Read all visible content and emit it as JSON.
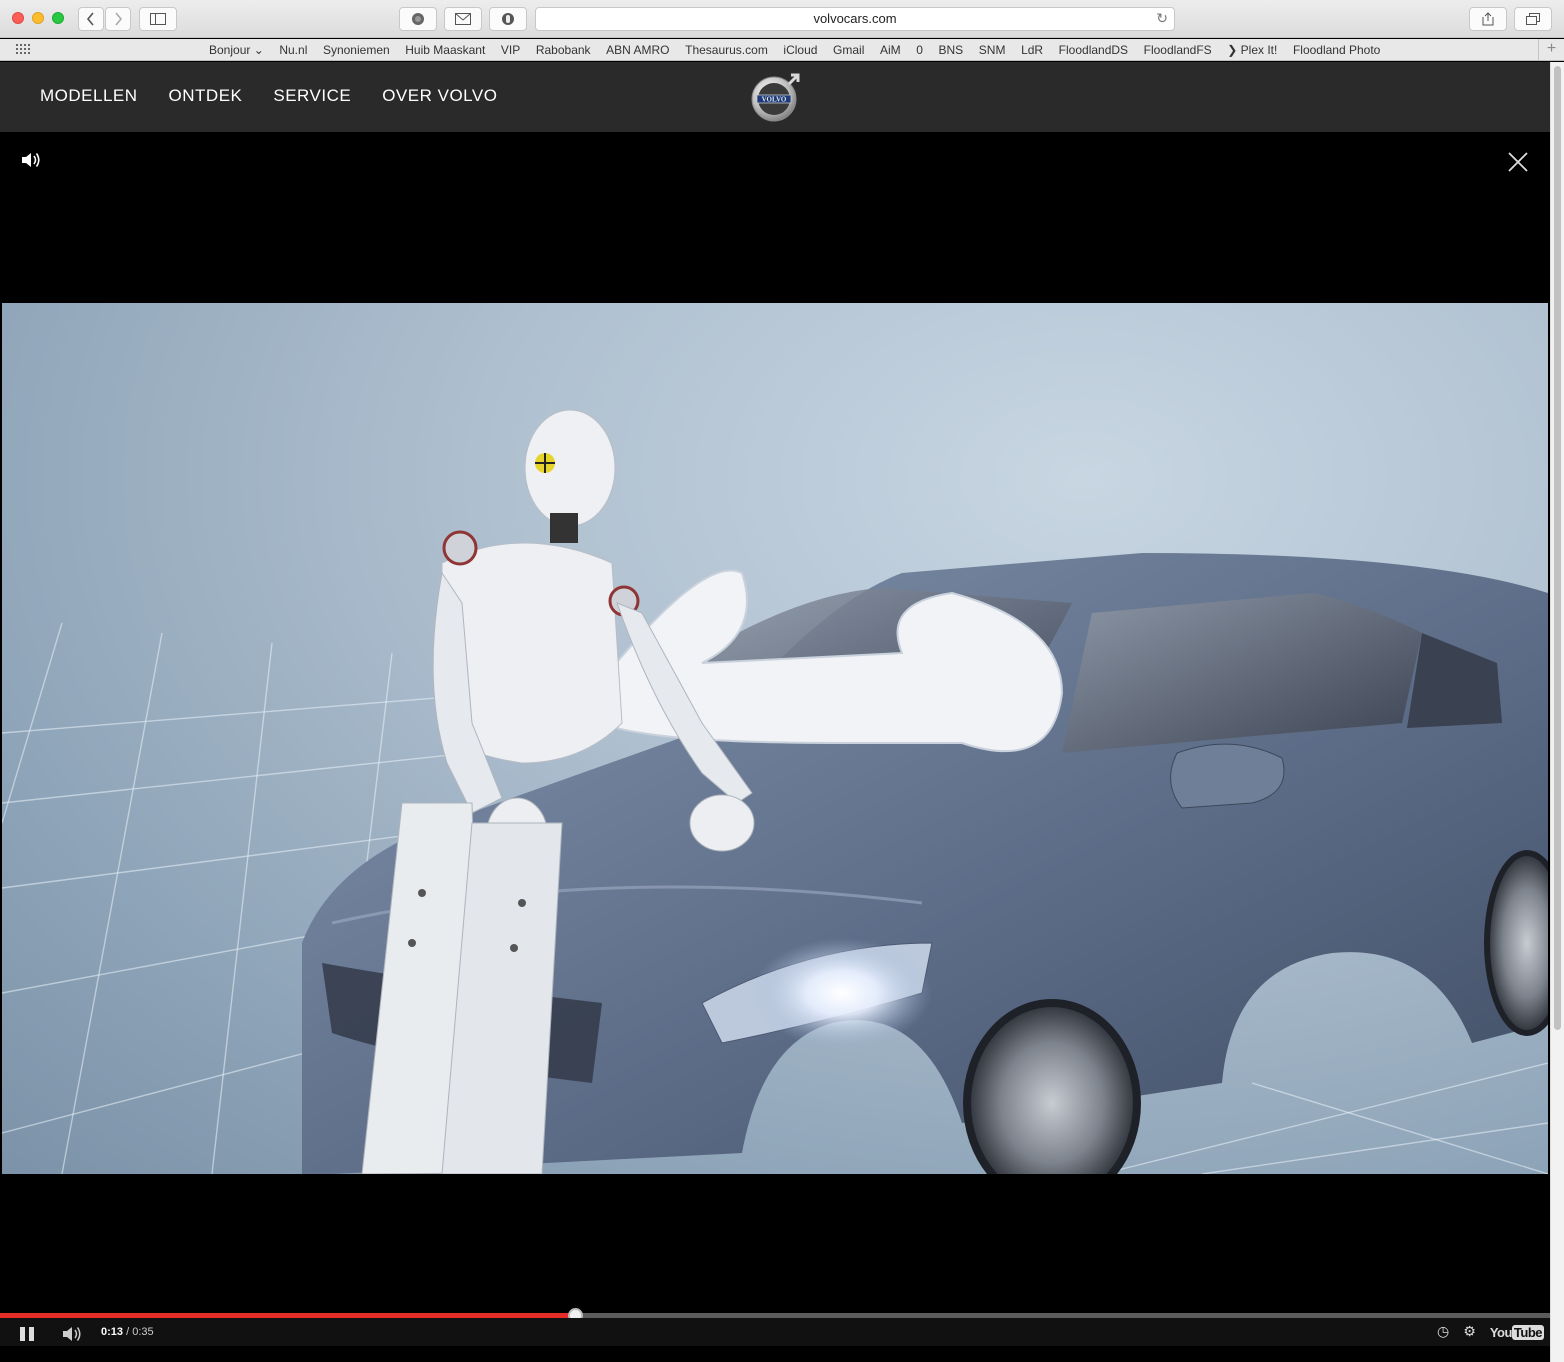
{
  "browser": {
    "url": "volvocars.com",
    "bookmarks": [
      "Bonjour ⌄",
      "Nu.nl",
      "Synoniemen",
      "Huib Maaskant",
      "VIP",
      "Rabobank",
      "ABN AMRO",
      "Thesaurus.com",
      "iCloud",
      "Gmail",
      "AiM",
      "0",
      "BNS",
      "SNM",
      "LdR",
      "FloodlandDS",
      "FloodlandFS",
      "❯ Plex It!",
      "Floodland Photo"
    ],
    "icons": [
      "back-icon",
      "forward-icon",
      "sidebar-icon",
      "reader-icon",
      "mail-icon",
      "privacy-icon",
      "reload-icon",
      "share-icon",
      "tabs-icon",
      "grid-icon",
      "plus-icon"
    ]
  },
  "site": {
    "nav": [
      "MODELLEN",
      "ONTDEK",
      "SERVICE",
      "OVER VOLVO"
    ],
    "logo_text": "VOLVO"
  },
  "video": {
    "current_time": "0:13",
    "duration": "/ 0:35",
    "progress": 0.3714,
    "brand": "You",
    "brand_box": "Tube",
    "colors": {
      "progress": "#e52d27",
      "nav_bg": "#2a2a2a"
    }
  }
}
